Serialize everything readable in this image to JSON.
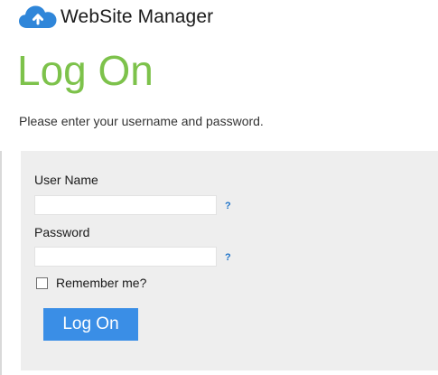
{
  "header": {
    "app_title": "WebSite Manager",
    "logo_icon": "cloud-upload-icon"
  },
  "page": {
    "heading": "Log On",
    "instructions": "Please enter your username and password."
  },
  "form": {
    "username": {
      "label": "User Name",
      "value": "",
      "help": "?"
    },
    "password": {
      "label": "Password",
      "value": "",
      "help": "?"
    },
    "remember": {
      "label": "Remember me?",
      "checked": false
    },
    "submit_label": "Log On"
  },
  "colors": {
    "heading_green": "#7dc24b",
    "button_blue": "#3a8ee6",
    "help_blue": "#1e73c8",
    "panel_gray": "#eeeeee"
  }
}
